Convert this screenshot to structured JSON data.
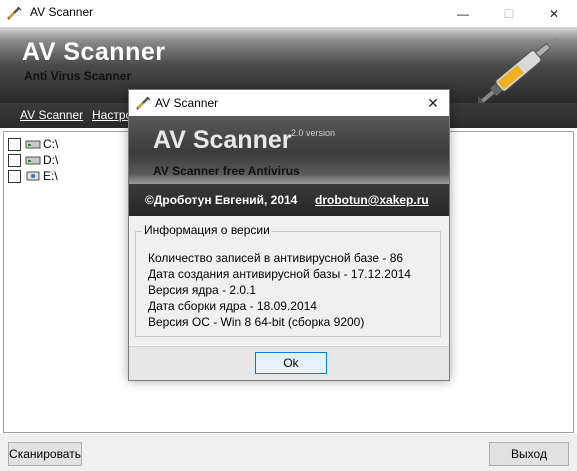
{
  "window": {
    "title": "AV Scanner",
    "controls": {
      "minimize": "—",
      "maximize": "☐",
      "close": "✕"
    }
  },
  "banner": {
    "title": "AV Scanner",
    "subtitle": "Anti Virus Scanner",
    "icon": "syringe-icon"
  },
  "menu": {
    "items": [
      {
        "label": "AV Scanner"
      },
      {
        "label": "Настро"
      }
    ]
  },
  "drives": [
    {
      "label": "C:\\",
      "icon": "hard-drive-icon"
    },
    {
      "label": "D:\\",
      "icon": "hard-drive-icon"
    },
    {
      "label": "E:\\",
      "icon": "usb-drive-icon"
    }
  ],
  "buttons": {
    "scan": "Сканировать",
    "exit": "Выход"
  },
  "dialog": {
    "title": "AV Scanner",
    "close": "✕",
    "banner_title": "AV Scanner",
    "version": "2.0 version",
    "banner_subtitle": "AV Scanner free Antivirus",
    "copyright": "©Дроботун Евгений, 2014",
    "email": "drobotun@xakep.ru",
    "group_title": "Информация о версии",
    "info_lines": [
      "Количество записей в антивирусной базе - 86",
      "Дата создания антивирусной базы - 17.12.2014",
      "Версия ядра - 2.0.1",
      "Дата сборки ядра - 18.09.2014",
      "Версия ОС - Win 8 64-bit (сборка 9200)"
    ],
    "ok": "Ok"
  }
}
